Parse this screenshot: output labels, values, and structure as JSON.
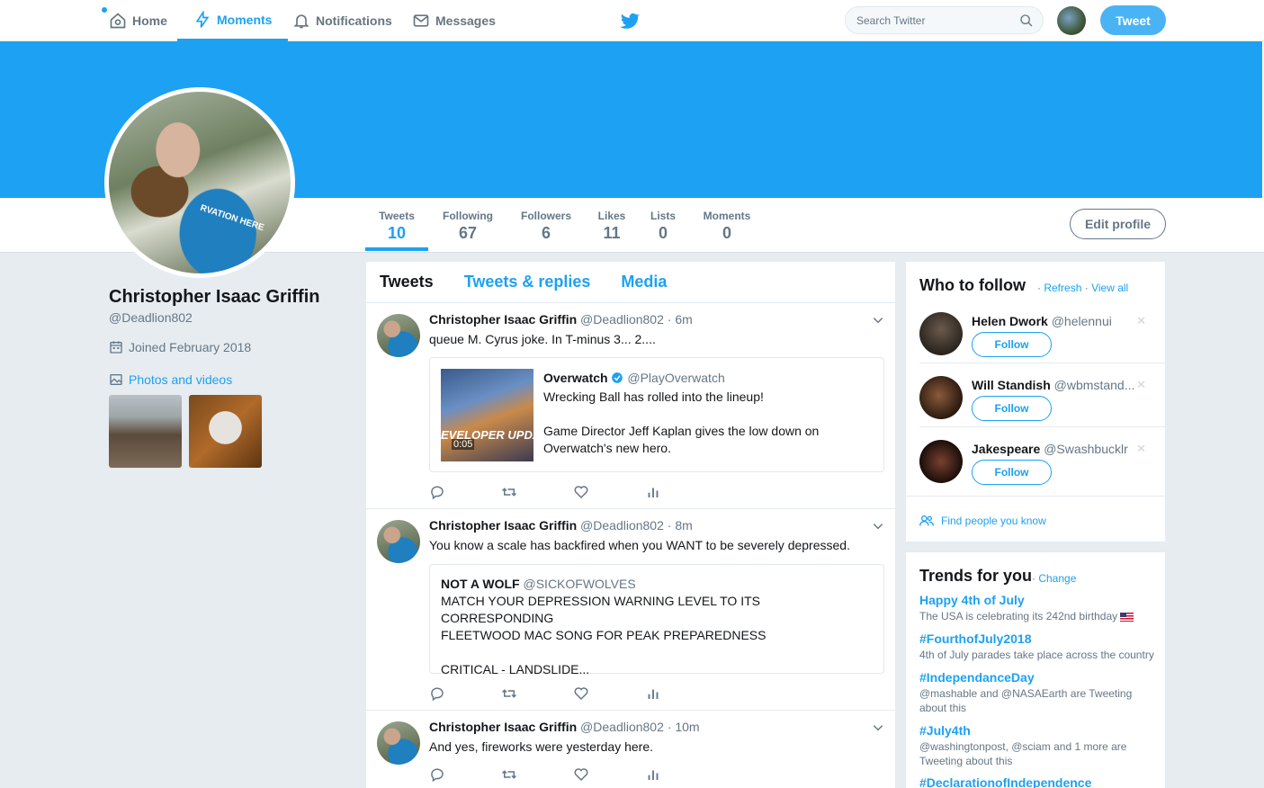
{
  "nav": {
    "home": "Home",
    "moments": "Moments",
    "notifications": "Notifications",
    "messages": "Messages",
    "search_placeholder": "Search Twitter",
    "tweet_button": "Tweet"
  },
  "profile": {
    "name": "Christopher Isaac Griffin",
    "handle": "@Deadlion802",
    "joined": "Joined February 2018",
    "photos_link": "Photos and videos",
    "shirt_text": "RVATION HERE",
    "edit_button": "Edit profile"
  },
  "stats": [
    {
      "label": "Tweets",
      "value": "10"
    },
    {
      "label": "Following",
      "value": "67"
    },
    {
      "label": "Followers",
      "value": "6"
    },
    {
      "label": "Likes",
      "value": "11"
    },
    {
      "label": "Lists",
      "value": "0"
    },
    {
      "label": "Moments",
      "value": "0"
    }
  ],
  "timeline": {
    "tabs": [
      "Tweets",
      "Tweets & replies",
      "Media"
    ],
    "tweets": [
      {
        "name": "Christopher Isaac Griffin",
        "meta": "@Deadlion802 · 6m",
        "text": "queue M. Cyrus joke. In T-minus 3... 2....",
        "quote": {
          "name": "Overwatch",
          "handle": "@PlayOverwatch",
          "line1": "Wrecking Ball has rolled into the lineup!",
          "line2": "Game Director Jeff Kaplan gives the low down on",
          "line3": "Overwatch's new hero.",
          "media_text": "EVELOPER UPDATE",
          "duration": "0:05"
        }
      },
      {
        "name": "Christopher Isaac Griffin",
        "meta": "@Deadlion802 · 8m",
        "text": "You know a scale has backfired when you WANT to be severely depressed.",
        "quote": {
          "name": "NOT A WOLF",
          "handle": "@SICKOFWOLVES",
          "line1": "MATCH YOUR DEPRESSION WARNING LEVEL TO ITS CORRESPONDING",
          "line2": "FLEETWOOD MAC SONG FOR PEAK PREPAREDNESS",
          "line3": "CRITICAL - LANDSLIDE..."
        }
      },
      {
        "name": "Christopher Isaac Griffin",
        "meta": "@Deadlion802 · 10m",
        "text": "And yes, fireworks were yesterday here."
      }
    ]
  },
  "who_to_follow": {
    "title": "Who to follow",
    "refresh": "Refresh",
    "view_all": "View all",
    "follow_label": "Follow",
    "users": [
      {
        "name": "Helen Dwork",
        "handle": "@helennui"
      },
      {
        "name": "Will Standish",
        "handle": "@wbmstand..."
      },
      {
        "name": "Jakespeare",
        "handle": "@Swashbucklr"
      }
    ],
    "find_people": "Find people you know"
  },
  "trends": {
    "title": "Trends for you",
    "change": "Change",
    "items": [
      {
        "name": "Happy 4th of July",
        "desc": "The USA is celebrating its 242nd birthday"
      },
      {
        "name": "#FourthofJuly2018",
        "desc": "4th of July parades take place across the country"
      },
      {
        "name": "#IndependanceDay",
        "desc": "@mashable and @NASAEarth are Tweeting about this"
      },
      {
        "name": "#July4th",
        "desc": "@washingtonpost, @sciam and 1 more are Tweeting about this"
      },
      {
        "name": "#DeclarationofIndependence",
        "desc": ""
      }
    ]
  },
  "colors": {
    "accent": "#1da1f2",
    "background": "#e6ecf0"
  }
}
